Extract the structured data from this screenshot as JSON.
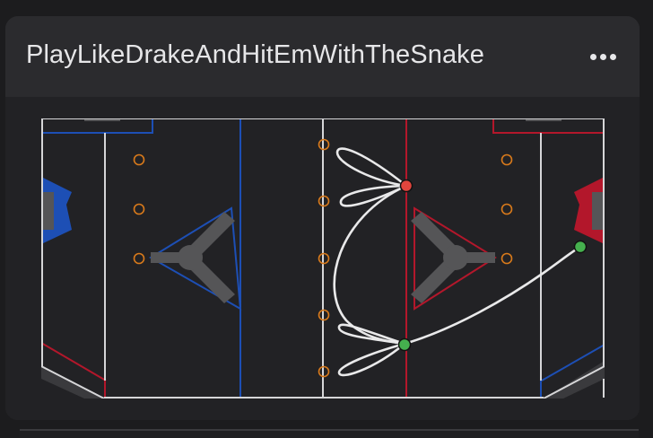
{
  "card": {
    "title": "PlayLikeDrakeAndHitEmWithTheSnake",
    "menu_icon": "more-horizontal-icon"
  },
  "colors": {
    "rink_background": "#222225",
    "boards": "#d6d6d8",
    "blue": "#1d4fb5",
    "red": "#b3172b",
    "faceoff_dot": "#d97a1b",
    "route": "#e9e9ea",
    "player_green": "#45b04e",
    "player_red": "#e0453d",
    "logo_grey": "#555557"
  },
  "players": [
    {
      "name": "player-red",
      "color": "red"
    },
    {
      "name": "player-green-center",
      "color": "green"
    },
    {
      "name": "player-green-right",
      "color": "green"
    }
  ]
}
